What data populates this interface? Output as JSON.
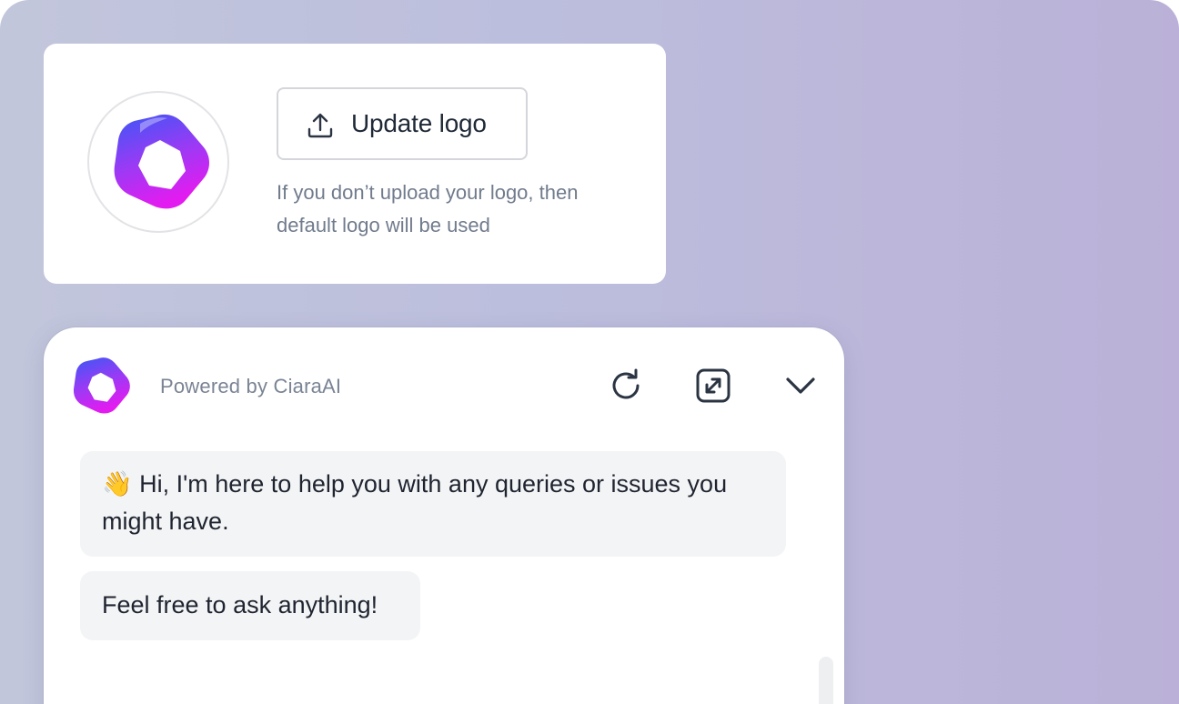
{
  "logo_settings": {
    "logo_icon": "ciara-logo-icon",
    "update_button": {
      "label": "Update logo",
      "icon": "upload-icon"
    },
    "hint_lines": [
      "If you don’t upload your logo, then",
      "default logo will be used"
    ]
  },
  "chat_widget": {
    "logo_icon": "ciara-logo-icon",
    "powered_by": "Powered by CiaraAI",
    "header_buttons": {
      "refresh": {
        "icon": "refresh-icon"
      },
      "expand": {
        "icon": "expand-icon"
      },
      "collapse": {
        "icon": "chevron-down-icon"
      }
    },
    "messages": [
      {
        "lines": [
          "👋 Hi, I'm here to help you with any queries or issues you",
          "might have."
        ]
      },
      {
        "lines": [
          "Feel free to ask anything!"
        ]
      }
    ]
  },
  "colors": {
    "background_left": "#c2c6db",
    "background_right": "#bbb1d8",
    "logo_gradient_top": "#3a58f5",
    "logo_gradient_bottom": "#e21cf0",
    "bubble_bg": "#f3f4f5",
    "icon_color": "#2b3442"
  }
}
